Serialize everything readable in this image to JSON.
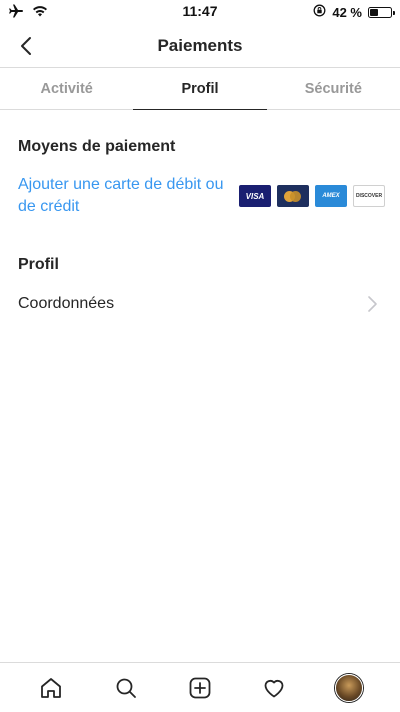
{
  "status_bar": {
    "time": "11:47",
    "battery_text": "42 %",
    "battery_level": 0.42,
    "icons": [
      "airplane-icon",
      "wifi-icon",
      "orientation-lock-icon",
      "battery-icon"
    ]
  },
  "nav": {
    "title": "Paiements",
    "back_icon": "chevron-left-icon"
  },
  "tabs": [
    {
      "label": "Activité",
      "active": false
    },
    {
      "label": "Profil",
      "active": true
    },
    {
      "label": "Sécurité",
      "active": false
    }
  ],
  "payment_section": {
    "title": "Moyens de paiement",
    "add_card_label": "Ajouter une carte de débit ou de crédit",
    "cards": [
      {
        "name": "visa",
        "label": "VISA"
      },
      {
        "name": "mastercard",
        "label": ""
      },
      {
        "name": "amex",
        "label": "AMEX"
      },
      {
        "name": "discover",
        "label": "DISCOVER"
      }
    ]
  },
  "profile_section": {
    "title": "Profil",
    "rows": [
      {
        "label": "Coordonnées",
        "icon": "chevron-right-icon"
      }
    ]
  },
  "bottom_nav": {
    "items": [
      "home-icon",
      "search-icon",
      "new-post-icon",
      "activity-heart-icon",
      "profile-avatar"
    ]
  },
  "colors": {
    "link": "#3897f0",
    "text": "#262626",
    "muted": "#999999",
    "divider": "#dbdbdb"
  }
}
